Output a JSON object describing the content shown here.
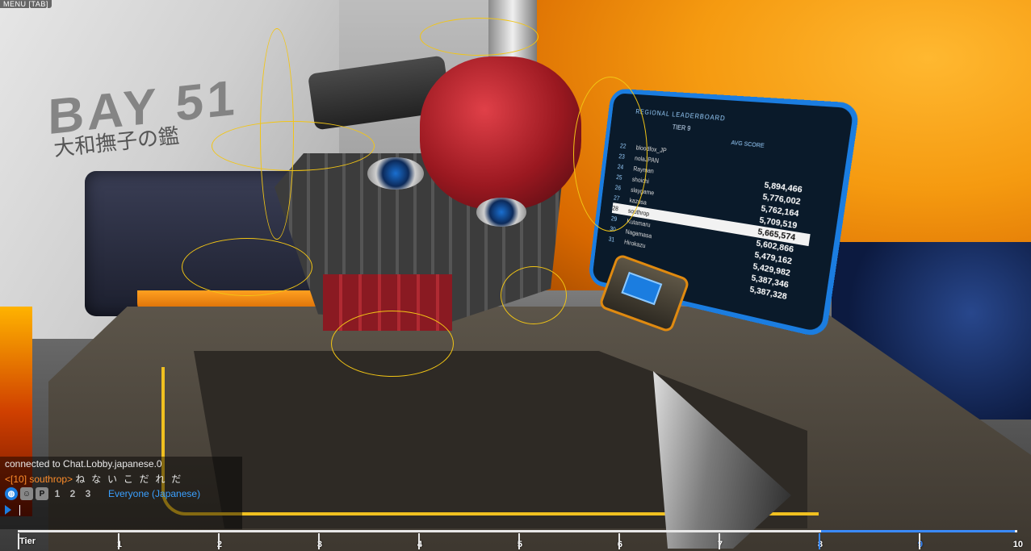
{
  "hud": {
    "menu_label": "MENU [TAB]"
  },
  "garage": {
    "bay_title": "BAY 51",
    "robot_name": "大和撫子の鑑"
  },
  "leaderboard": {
    "title": "REGIONAL LEADERBOARD",
    "tier": "TIER 9",
    "column_header": "AVG SCORE",
    "rows": [
      {
        "rank": "22",
        "name": "bloodfox_JP",
        "score": ""
      },
      {
        "rank": "23",
        "name": "nolaJPAN",
        "score": ""
      },
      {
        "rank": "24",
        "name": "Rayman",
        "score": "5,894,466"
      },
      {
        "rank": "25",
        "name": "shoichi",
        "score": "5,776,002"
      },
      {
        "rank": "26",
        "name": "slaygame",
        "score": "5,762,164"
      },
      {
        "rank": "27",
        "name": "kazusa",
        "score": "5,709,519"
      },
      {
        "rank": "28",
        "name": "southrop",
        "score": "5,665,574",
        "highlight": true
      },
      {
        "rank": "29",
        "name": "Kutamaru",
        "score": "5,602,866"
      },
      {
        "rank": "30",
        "name": "Nagamasa",
        "score": "5,479,162"
      },
      {
        "rank": "31",
        "name": "Hirokazu",
        "score": "5,429,982"
      },
      {
        "rank": "",
        "name": "",
        "score": "5,387,346"
      },
      {
        "rank": "",
        "name": "",
        "score": "5,387,328"
      }
    ]
  },
  "chat": {
    "system_message": "connected to Chat.Lobby.japanese.0",
    "message_user": "<[10] southrop>",
    "message_text": "ね な い こ だ れ だ",
    "tools": [
      {
        "icon": "globe-icon",
        "glyph": "◍"
      },
      {
        "icon": "friends-icon",
        "glyph": "☺"
      },
      {
        "icon": "party-icon",
        "glyph": "P"
      },
      {
        "icon": "person-1-icon",
        "glyph": "1"
      },
      {
        "icon": "person-2-icon",
        "glyph": "2"
      },
      {
        "icon": "person-3-icon",
        "glyph": "3"
      }
    ],
    "channel": "Everyone (Japanese)",
    "input_value": ""
  },
  "tier_progress": {
    "label": "Tier",
    "tiers": [
      "1",
      "2",
      "3",
      "4",
      "5",
      "6",
      "7",
      "8",
      "9",
      "10"
    ],
    "current_tier": "9",
    "accent_color": "#3a8aff"
  },
  "colors": {
    "chat_user": "#ff8c2a",
    "chat_channel": "#3aa0ff",
    "gyro_ring": "#f2c515",
    "leaderboard_border": "#1b7de0"
  }
}
